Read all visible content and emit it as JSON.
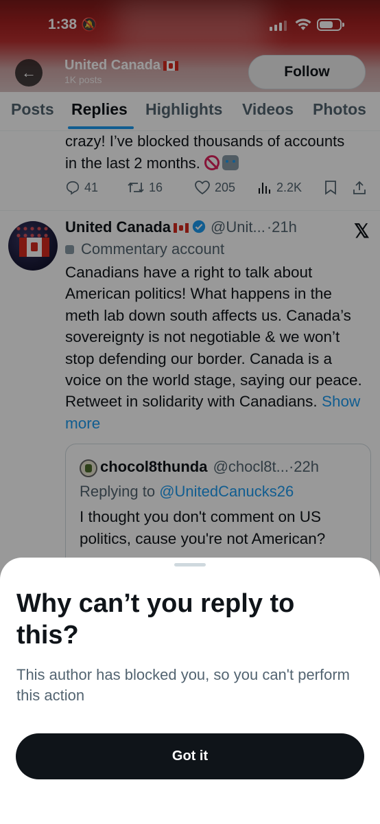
{
  "status_bar": {
    "time": "1:38"
  },
  "profile": {
    "name": "United Canada",
    "posts_count": "1K posts",
    "follow_label": "Follow"
  },
  "tabs": [
    "Posts",
    "Replies",
    "Highlights",
    "Videos",
    "Photos"
  ],
  "active_tab": "Replies",
  "previous_post": {
    "text": "crazy! I’ve blocked thousands of accounts in the last 2 months.",
    "replies": "41",
    "reposts": "16",
    "likes": "205",
    "views": "2.2K"
  },
  "post": {
    "author": "United Canada",
    "handle": "@Unit...",
    "time": "·21h",
    "label": "Commentary account",
    "text": "Canadians have a right to talk about American politics! What happens in the meth lab down south affects us. Canada’s sovereignty is not negotiable & we won’t stop defending our border. Canada is a voice on the world stage, saying our peace. Retweet in solidarity with Canadians.",
    "show_more": "Show more"
  },
  "quote": {
    "author": "chocol8thunda",
    "handle": "@chocl8t...",
    "time": "·22h",
    "replying_prefix": "Replying to",
    "replying_to": "@UnitedCanucks26",
    "text": "I thought you don't comment on US politics, cause you're not American?"
  },
  "sheet": {
    "title": "Why can’t you reply to this?",
    "body": "This author has blocked you, so you can't perform this action",
    "button": "Got it"
  },
  "colors": {
    "accent": "#1d9bf0",
    "text": "#0f1419",
    "muted": "#536471",
    "flag_red": "#d52b1e"
  }
}
